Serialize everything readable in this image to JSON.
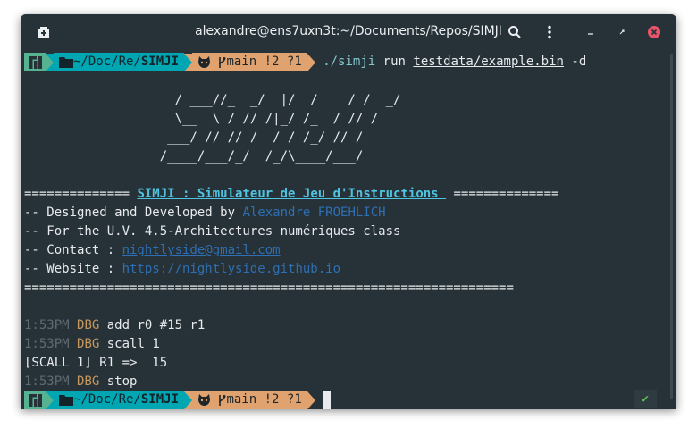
{
  "window": {
    "title": "alexandre@ens7uxn3t:~/Documents/Repos/SIMJI",
    "icons": {
      "new_tab": "new-tab-icon",
      "search": "search-icon",
      "menu": "kebab-menu-icon",
      "minimize": "minimize-icon",
      "maximize": "maximize-icon",
      "close": "close-icon"
    }
  },
  "prompt": {
    "os_icon": "manjaro-logo-icon",
    "folder_icon": "folder-icon",
    "path_prefix": "~/Doc/Re/",
    "path_current": "SIMJI",
    "git_icon": "github-icon",
    "branch_icon": "git-branch-icon",
    "branch": "main",
    "git_status": "!2 ?1"
  },
  "command": {
    "exec": "./simji",
    "verb": "run",
    "file": "testdata/example.bin",
    "flag": "-d"
  },
  "banner": {
    "ascii": [
      "                     _____ ________  ___     ______",
      "                    / ___//_  _/  |/  /    / /  _/",
      "                    \\__  \\ / // /|_/ /_  / // /",
      "                   ___/ // // /  / / /_/ // /",
      "                  /____/___/_/  /_/\\____/___/"
    ],
    "rule_left": "==============",
    "title": "SIMJI : Simulateur de Jeu d'Instructions ",
    "rule_right": "==============",
    "designed_label": "-- Designed and Developed by ",
    "author": "Alexandre FROEHLICH",
    "course": "-- For the U.V. 4.5-Architectures numériques class",
    "contact_label": "-- Contact : ",
    "contact": "nightlyside@gmail.com",
    "website_label": "-- Website : ",
    "website": "https://nightlyside.github.io",
    "rule_full": "================================================================="
  },
  "log": [
    {
      "time": "1:53PM",
      "level": "DBG",
      "msg": "add r0 #15 r1"
    },
    {
      "time": "1:53PM",
      "level": "DBG",
      "msg": "scall 1"
    },
    {
      "time": "",
      "level": "",
      "msg": "[SCALL 1] R1 =>  15"
    },
    {
      "time": "1:53PM",
      "level": "DBG",
      "msg": "stop"
    }
  ],
  "status": {
    "icon": "checkmark-icon",
    "symbol": "✔"
  },
  "colors": {
    "background": "#263238",
    "os_segment": "#56b392",
    "dir_segment": "#00a6b2",
    "git_segment": "#e0a370",
    "accent": "#4fc3e0"
  }
}
